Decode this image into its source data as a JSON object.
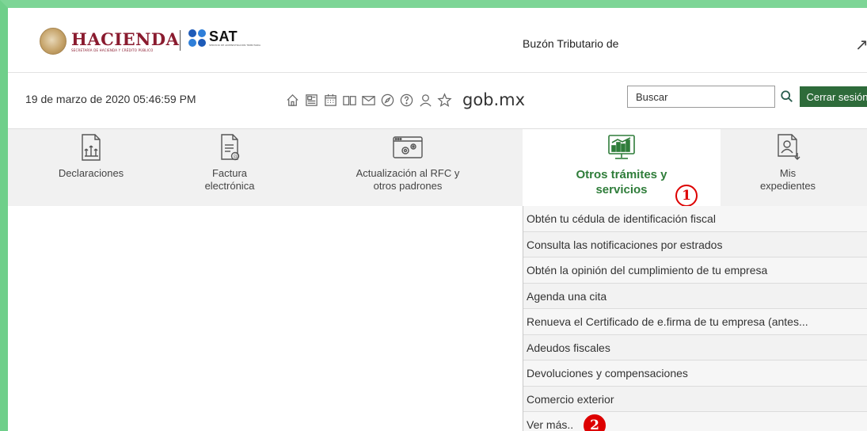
{
  "header": {
    "hacienda_title": "HACIENDA",
    "hacienda_subtitle": "SECRETARÍA DE HACIENDA Y CRÉDITO PÚBLICO",
    "sat_title": "SAT",
    "sat_subtitle": "SERVICIO DE ADMINISTRACIÓN TRIBUTARIA",
    "page_title": "Buzón Tributario de"
  },
  "toolbar": {
    "datetime": "19 de marzo de 2020 05:46:59 PM",
    "icons": [
      "home-icon",
      "news-icon",
      "calendar-icon",
      "book-icon",
      "mail-icon",
      "compass-icon",
      "help-icon",
      "user-icon",
      "star-icon"
    ],
    "gob_label": "gob.mx",
    "search_placeholder": "Buscar",
    "logout_label": "Cerrar sesión"
  },
  "nav": {
    "items": [
      {
        "label": "Declaraciones",
        "icon": "document-chart-icon"
      },
      {
        "label": "Factura\nelectrónica",
        "icon": "invoice-icon"
      },
      {
        "label": "Actualización al RFC y\notros padrones",
        "icon": "settings-window-icon"
      },
      {
        "label": "Otros trámites y\nservicios",
        "icon": "monitor-chart-icon",
        "active": true
      },
      {
        "label": "Mis\nexpedientes",
        "icon": "folder-person-icon"
      }
    ],
    "step1": "1",
    "step2": "2"
  },
  "dropdown": {
    "items": [
      "Obtén tu cédula de identificación fiscal",
      "Consulta las notificaciones por estrados",
      "Obtén la opinión del cumplimiento de tu empresa",
      "Agenda una cita",
      "Renueva el Certificado de e.firma de tu empresa (antes...",
      "Adeudos fiscales",
      "Devoluciones y compensaciones",
      "Comercio exterior",
      "Ver más.."
    ]
  },
  "colors": {
    "accent_green": "#2e6b3a",
    "active_text": "#2f7d3a",
    "hacienda_red": "#8a1b2f",
    "annotation_red": "#dd0000"
  }
}
